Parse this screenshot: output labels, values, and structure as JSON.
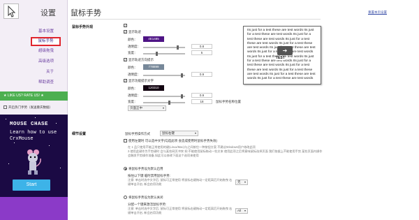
{
  "sidebar": {
    "title": "设置",
    "logo_icon": "cursor-logo-icon",
    "items": [
      {
        "label": "基本设置"
      },
      {
        "label": "鼠标手势"
      },
      {
        "label": "超级拖曳"
      },
      {
        "label": "高级选项"
      },
      {
        "label": "关于"
      },
      {
        "label": "帮助调查"
      }
    ],
    "active_index": 1,
    "like_label": "★ LIKE US? RATE US! ★",
    "open_label": "开启热门手势（发送重庆数据）"
  },
  "ad": {
    "title": "MOUSE CHASE",
    "subtitle": "Learn how to use CrxMouse",
    "start_label": "Start",
    "bg_color": "#1b0a44",
    "floor_color": "#8b3ac8",
    "button_color": "#3db3e8"
  },
  "main": {
    "page_title": "鼠标手势",
    "restore_link": "重置本页设置",
    "appearance": {
      "section_label": "鼠标手势外观",
      "show_track_label": "显示轨迹",
      "color_label": "颜色：",
      "track_color": "4E1485",
      "opacity_label": "透明度：",
      "track_opacity": "0.8",
      "width_label": "宽度：",
      "track_width": "5",
      "show_direction_label": "显示轨迹方向提示",
      "direction_color": "778899",
      "direction_opacity": "0.9",
      "show_action_label": "显示功能提示文字",
      "action_color": "120310",
      "action_opacity": "0.9",
      "action_width": "18",
      "name_position_label": "鼠标手势名称位置",
      "position_select": "页面正中"
    },
    "preview": {
      "text": "Its just for a test these are test words Its just for a test these are test words Its just for a test these are test words Its just for a test these are test words Its just for a test these are test words Its just for a test these are test words Its just for a test these are test words Its just for a test these are test words Its just for a test these are test words Its just for a test these are test words Its just for a test these are test words Its just for a test these are test words Its just for a test these are test words Its just for a test these are test words",
      "tag_glyph": "➔",
      "tag_label": "TEST"
    },
    "details": {
      "section_label": "细节设置",
      "trigger_label": "鼠标手势操作方式",
      "trigger_select": "鼠标右键",
      "use_left_label": "使用左键时 可以选中文字(勾选此项 会造成使用时鼠标手势失效)",
      "note1": "在 1 品只使用不能正常使用的键(Linux/Mac)与之间按住一种按钮方案 不建议Windows用户修改此项",
      "note2": "2.使用此键作为手势键时 会与某些网页冲突 如:不能使用鼠标拖动一些文本 使用此项之后将意味鼠标选择页面 我们依据上不能使用手势 某些页面内操作会触发手势操作准备,如此可以修改下面这个选项来使用",
      "radio1_label": "将鼠标手势设为默认启用",
      "radio1_sub": "按住以下键 临时禁用鼠标手势:",
      "radio1_desc": "注意: 单击时选中文字后, 鼠标可正常使用 将鼠标右键拖动一定距离后开始拖曳 右键单击开启, 新会启用功能",
      "key_label": "无",
      "radio2_label": "将鼠标手势设为默认关闭",
      "radio2_sub": "分配一个键来激活鼠标手势:",
      "radio2_desc": "注意: 单击时选中文字后, 鼠标可正常使用 将鼠标右键拖动一定距离后开始拖曳 右键单击开启, 新会启用功能",
      "key2_label": "All"
    }
  },
  "colors": {
    "accent": "#6b3fa0",
    "like_green": "#4caf50",
    "active_border": "#e0252d",
    "track": "#4E1485",
    "direction": "#778899",
    "action": "#120310"
  }
}
